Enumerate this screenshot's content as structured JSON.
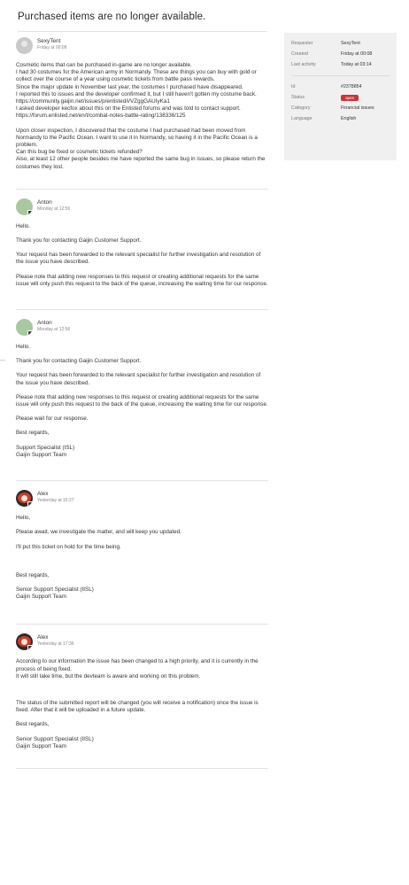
{
  "page_title": "Purchased items are no longer available.",
  "sidebar": {
    "rows_top": [
      {
        "label": "Requester",
        "value": "SexyTent"
      },
      {
        "label": "Created",
        "value": "Friday at 00:08"
      },
      {
        "label": "Last activity",
        "value": "Today at 03:14"
      }
    ],
    "rows_bottom": [
      {
        "label": "Id",
        "value": "#2378854"
      },
      {
        "label": "Status",
        "value": "open"
      },
      {
        "label": "Category",
        "value": "Financial issues"
      },
      {
        "label": "Language",
        "value": "English"
      }
    ],
    "status_color": "#cc3333"
  },
  "messages": [
    {
      "author": "SexyTent",
      "time": "Friday at 00:08",
      "paragraphs": [
        [
          "Cosmetic items that can be purchased in-game are no longer available.",
          "I had 30 costumes for the American army in Normandy. These are things you can buy with gold or collect over the course of a year using cosmetic tickets from battle pass rewards.",
          "Since the major update in November last year, the costumes I purchased have disappeared.",
          "I reported this to issues and the developer confirmed it, but I still haven't gotten my costume back.",
          "https://community.gaijin.net/issues/p/enlisted/i/VZggGAUIyKa1",
          "I asked developer kecfox about this on the Enlisted forums and was told to contact support.",
          "https://forum.enlisted.net/en/t/combat-notes-battle-rating/138336/125"
        ],
        [
          "Upon closer inspection, I discovered that the costume I had purchased had been moved from Normandy to the Pacific Ocean. I want to use it in Normandy, so having it in the Pacific Ocean is a problem.",
          "Can this bug be fixed or cosmetic tickets refunded?",
          "Also, at least 12 other people besides me have reported the same bug in issues, so please return the costumes they lost."
        ]
      ]
    },
    {
      "author": "Anton",
      "time": "Monday at 12:56",
      "paragraphs": [
        [
          "Hello."
        ],
        [
          "Thank you for contacting Gaijin Customer Support."
        ],
        [
          "Your request has been forwarded to the relevant specialist for further investigation and resolution of the issue you have described."
        ],
        [
          "Please note that adding new responses to this request or creating additional requests for the same issue will only push this request to the back of the queue, increasing the waiting time for our response."
        ]
      ]
    },
    {
      "author": "Anton",
      "time": "Monday at 12:56",
      "paragraphs": [
        [
          "Hello."
        ],
        [
          "Thank you for contacting Gaijin Customer Support."
        ],
        [
          "Your request has been forwarded to the relevant specialist for further investigation and resolution of the issue you have described."
        ],
        [
          "Please note that adding new responses to this request or creating additional requests for the same issue will only push this request to the back of the queue, increasing the waiting time for our response."
        ],
        [
          "Please wait for our response."
        ],
        [
          "Best regards,"
        ],
        [
          "Support Specialist (ISL)",
          "Gaijin Support Team"
        ]
      ]
    },
    {
      "author": "Alex",
      "time": "Yesterday at 15:27",
      "paragraphs": [
        [
          "Hello,"
        ],
        [
          "Please await, we investigate the matter, and will keep you updated."
        ],
        [
          "I'll put this ticket on hold for the time being."
        ],
        [
          "Best regards,"
        ],
        [
          "Senior Support Specialist (IISL)",
          "Gaijin Support Team"
        ]
      ]
    },
    {
      "author": "Alex",
      "time": "Yesterday at 17:36",
      "paragraphs": [
        [
          "According to our information the issue has been changed to a high priority, and it is currently in the process of being fixed.",
          "It will still take time, but the devteam is aware and working on this problem."
        ],
        [
          "The status of the submitted report will be changed (you will receive a notification) once the issue is fixed. After that it will be uploaded in a future update."
        ],
        [
          "Best regards,"
        ],
        [
          "Senior Support Specialist (IISL)",
          "Gaijin Support Team"
        ]
      ]
    }
  ]
}
